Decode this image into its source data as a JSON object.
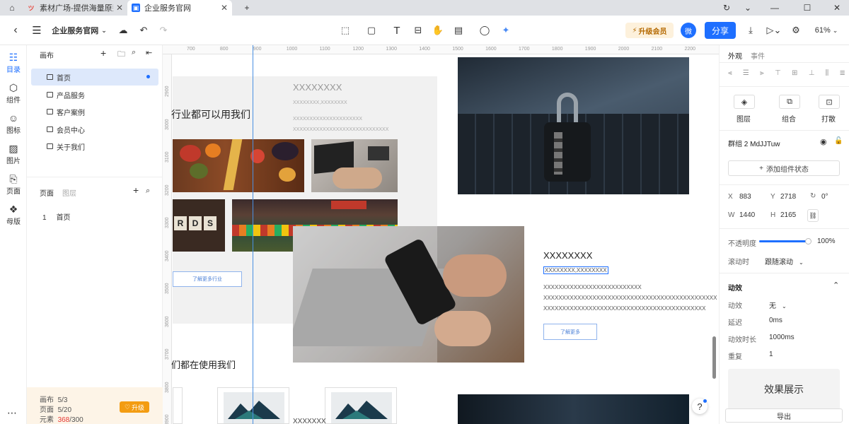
{
  "browser": {
    "tabs": [
      {
        "label": "素材广场-提供海量原型模",
        "active": false
      },
      {
        "label": "企业服务官网",
        "active": true
      }
    ]
  },
  "toolbar": {
    "project_name": "企业服务官网",
    "upgrade_label": "升级会员",
    "wechat_badge": "微",
    "share_label": "分享",
    "zoom": "61%"
  },
  "leftnav": {
    "items": [
      {
        "label": "目录",
        "icon": "list-icon",
        "active": true
      },
      {
        "label": "组件",
        "icon": "component-icon",
        "active": false
      },
      {
        "label": "图标",
        "icon": "emoji-icon",
        "active": false
      },
      {
        "label": "图片",
        "icon": "image-icon",
        "active": false
      },
      {
        "label": "页面",
        "icon": "page-icon",
        "active": false
      },
      {
        "label": "母版",
        "icon": "master-icon",
        "active": false
      }
    ]
  },
  "layers": {
    "canvas_title": "画布",
    "canvas_items": [
      "首页",
      "产品服务",
      "客户案例",
      "会员中心",
      "关于我们"
    ],
    "tabs": [
      "页面",
      "图层"
    ],
    "page_items": [
      {
        "num": "1",
        "label": "首页"
      }
    ],
    "quota": {
      "canvas_label": "画布",
      "canvas_value": "5/3",
      "page_label": "页面",
      "page_value": "5/20",
      "element_label": "元素",
      "element_used": "368",
      "element_total": "/300"
    },
    "upgrade_label": "升级"
  },
  "canvas": {
    "ruler_h": [
      "700",
      "800",
      "900",
      "1000",
      "1100",
      "1200",
      "1300",
      "1400",
      "1500",
      "1600",
      "1700",
      "1800",
      "1900",
      "2000",
      "2100",
      "2200"
    ],
    "ruler_v": [
      "2900",
      "3000",
      "3100",
      "3200",
      "3300",
      "3400",
      "3500",
      "3600",
      "3700",
      "3800",
      "3900"
    ],
    "section1_heading": "行业都可以用我们",
    "card_title": "XXXXXXXX",
    "card_subtitle": "XXXXXXXX,XXXXXXXX",
    "card_line1": "XXXXXXXXXXXXXXXXXXXXX",
    "card_line2": "XXXXXXXXXXXXXXXXXXXXXXXXXXXXX",
    "more_industry_btn": "了解更多行业",
    "feature_title": "XXXXXXXX",
    "feature_subtitle": "XXXXXXXX,XXXXXXXX",
    "feature_line1": "XXXXXXXXXXXXXXXXXXXXXXXXXX",
    "feature_line2": "XXXXXXXXXXXXXXXXXXXXXXXXXXXXXXXXXXXXXXXXXXXXXX",
    "feature_line3": "XXXXXXXXXXXXXXXXXXXXXXXXXXXXXXXXXXXXXXXXXXX",
    "learn_more_btn": "了解更多",
    "section2_heading": "们都在使用我们",
    "scrabble_text": "R D S",
    "bottom_text": "XXXXXXX",
    "help_icon": "?"
  },
  "rightpanel": {
    "tabs": [
      "外观",
      "事件"
    ],
    "layer_buttons": [
      "图层",
      "组合",
      "打散"
    ],
    "group_name": "群组 2 MdJJTuw",
    "add_state_label": "添加组件状态",
    "x_label": "X",
    "x_value": "883",
    "y_label": "Y",
    "y_value": "2718",
    "rotation_value": "0°",
    "w_label": "W",
    "w_value": "1440",
    "h_label": "H",
    "h_value": "2165",
    "opacity_label": "不透明度",
    "opacity_value": "100%",
    "opacity_level": 1.0,
    "scroll_label": "滚动时",
    "scroll_value": "跟随滚动",
    "animation_title": "动效",
    "effect_label": "动效",
    "effect_value": "无",
    "delay_label": "延迟",
    "delay_value": "0ms",
    "duration_label": "动效时长",
    "duration_value": "1000ms",
    "repeat_label": "重复",
    "repeat_value": "1",
    "preview_label": "效果展示",
    "export_label": "导出"
  }
}
